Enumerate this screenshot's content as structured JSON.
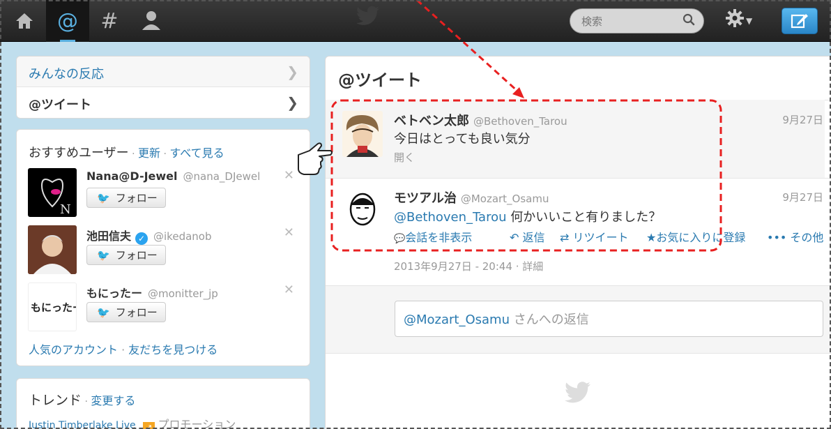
{
  "topnav": {
    "home_icon": "home-icon",
    "connect_label": "@",
    "discover_label": "#",
    "me_icon": "person-icon"
  },
  "search": {
    "placeholder": "検索"
  },
  "nav": {
    "items": [
      {
        "label": "みんなの反応"
      },
      {
        "label": "@ツイート"
      }
    ]
  },
  "suggest": {
    "title": "おすすめユーザー",
    "sep1": " · ",
    "refresh": "更新",
    "sep2": " · ",
    "view_all": "すべて見る",
    "follow_label": "フォロー",
    "users": [
      {
        "name": "Nana@D-Jewel",
        "handle": "@nana_DJewel"
      },
      {
        "name": "池田信夫",
        "handle": "@ikedanob"
      },
      {
        "name": "もにったー",
        "handle": "@monitter_jp"
      }
    ],
    "footer_popular": "人気のアカウント",
    "footer_sep": " · ",
    "footer_find": "友だちを見つける"
  },
  "trends": {
    "title": "トレンド",
    "sep": " · ",
    "change": "変更する",
    "item1": "Justin Timberlake Live",
    "promo": "プロモーション"
  },
  "main": {
    "title": "@ツイート",
    "tweet1": {
      "name": "ベトベン太郎",
      "handle": "@Bethoven_Tarou",
      "date": "9月27日",
      "text": "今日はとっても良い気分",
      "open": "開く"
    },
    "tweet2": {
      "name": "モツアル治",
      "handle": "@Mozart_Osamu",
      "date": "9月27日",
      "mention": "@Bethoven_Tarou",
      "text": " 何かいいこと有りました？",
      "actions": {
        "hide": "会話を非表示",
        "reply": "返信",
        "retweet": "リツイート",
        "favorite": "お気に入りに登録",
        "more": "その他"
      },
      "meta_date": "2013年9月27日 - 20:44",
      "meta_sep": " · ",
      "details": "詳細"
    },
    "reply_mention": "@Mozart_Osamu",
    "reply_suffix": " さんへの返信"
  },
  "colors": {
    "accent": "#2a7ab0",
    "annotation": "#e82020",
    "topbar": "#2b2b2b",
    "bg": "#c0deed"
  }
}
